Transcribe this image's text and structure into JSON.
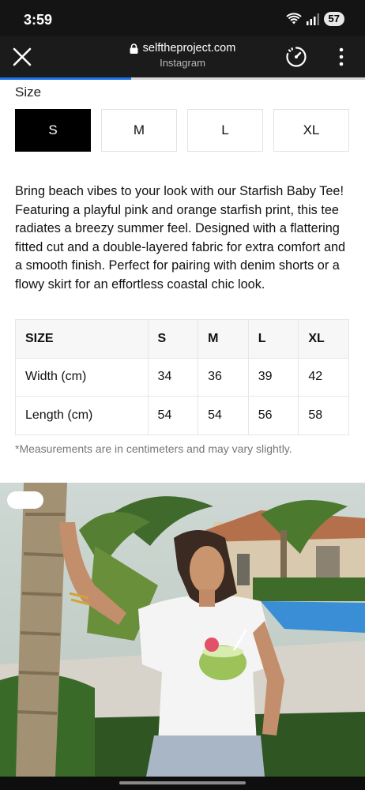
{
  "status_bar": {
    "time": "3:59",
    "battery": "57"
  },
  "browser": {
    "domain": "selftheproject.com",
    "app_name": "Instagram",
    "load_progress_pct": 36
  },
  "product": {
    "size_label": "Size",
    "sizes": [
      "S",
      "M",
      "L",
      "XL"
    ],
    "selected_size": "S",
    "description": "Bring beach vibes to your look with our Starfish Baby Tee! Featuring a playful pink and orange starfish print, this tee radiates a breezy summer feel. Designed with a flattering fitted cut and a double-layered fabric for extra comfort and a smooth finish. Perfect for pairing with denim shorts or a flowy skirt for an effortless coastal chic look.",
    "size_chart": {
      "headers": [
        "SIZE",
        "S",
        "M",
        "L",
        "XL"
      ],
      "rows": [
        [
          "Width (cm)",
          "34",
          "36",
          "39",
          "42"
        ],
        [
          "Length (cm)",
          "54",
          "54",
          "56",
          "58"
        ]
      ]
    },
    "measurement_note": "*Measurements are in centimeters and may vary slightly."
  },
  "colors": {
    "accent": "#1a73e8",
    "selected_size_bg": "#000000"
  }
}
